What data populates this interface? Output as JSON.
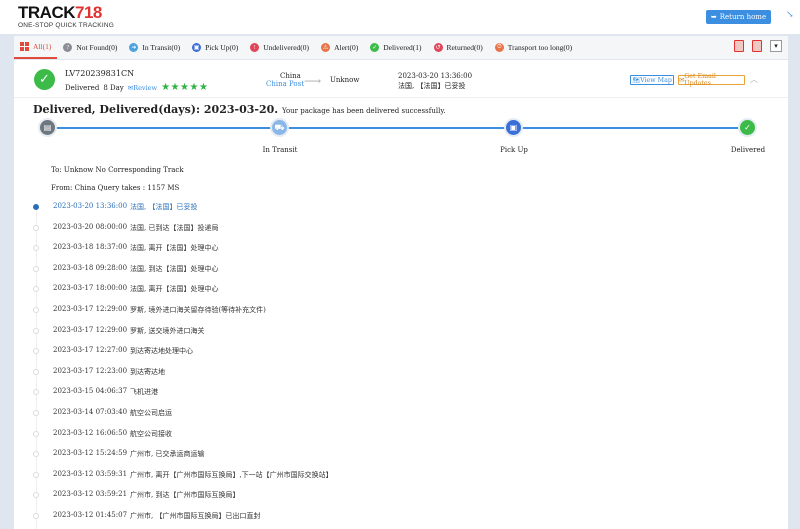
{
  "brand": {
    "logo_a": "TRACK",
    "logo_b": "718",
    "tagline": "ONE-STOP QUICK TRACKING"
  },
  "header": {
    "return_label": "Return home"
  },
  "filters": [
    {
      "label": "All(1)",
      "icon": "grid-icon",
      "color": "#e24b3b"
    },
    {
      "label": "Not Found(0)",
      "icon": "not-found-icon",
      "color": "#8a8f96"
    },
    {
      "label": "In Transit(0)",
      "icon": "in-transit-icon",
      "color": "#4aa3df"
    },
    {
      "label": "Pick Up(0)",
      "icon": "pickup-icon",
      "color": "#3b6fd8"
    },
    {
      "label": "Undelivered(0)",
      "icon": "undelivered-icon",
      "color": "#e0455a"
    },
    {
      "label": "Alert(0)",
      "icon": "alert-icon",
      "color": "#e8744a"
    },
    {
      "label": "Delivered(1)",
      "icon": "delivered-icon",
      "color": "#3dbb48"
    },
    {
      "label": "Returned(0)",
      "icon": "returned-icon",
      "color": "#e0455a"
    },
    {
      "label": "Transport too long(0)",
      "icon": "transport-long-icon",
      "color": "#e8744a"
    }
  ],
  "package": {
    "tracking_number": "LV720239831CN",
    "status": "Delivered",
    "days": "8 Day",
    "review_label": "Review",
    "stars": "★★★★★",
    "origin_country": "China",
    "origin_carrier": "China Post",
    "destination": "Unknow",
    "latest_time": "2023-03-20 13:36:00",
    "latest_desc": "法国, 【法国】已妥投",
    "view_map": "View Map",
    "email_updates": "Get Email Updates"
  },
  "summary": {
    "headline": "Delivered, Delivered(days): 2023-03-20.",
    "subtext": "Your package has been delivered successfully."
  },
  "steps": [
    {
      "label": "",
      "icon": "info-box-icon",
      "color": "#6e7680"
    },
    {
      "label": "In Transit",
      "icon": "truck-icon",
      "color": "#8ab7e8"
    },
    {
      "label": "Pick Up",
      "icon": "pickup-box-icon",
      "color": "#3b6fd8"
    },
    {
      "label": "Delivered",
      "icon": "check-icon",
      "color": "#3dbb48"
    }
  ],
  "route_info": {
    "to_text": "To: Unknow    No Corresponding Track",
    "from_text": "From: China   Query takes : 1157 MS"
  },
  "events": [
    {
      "time": "2023-03-20 13:36:00",
      "desc": "法国, 【法国】已妥投"
    },
    {
      "time": "2023-03-20 08:00:00",
      "desc": "法国, 已到达【法国】投递局"
    },
    {
      "time": "2023-03-18 18:37:00",
      "desc": "法国, 离开【法国】处理中心"
    },
    {
      "time": "2023-03-18 09:28:00",
      "desc": "法国, 到达【法国】处理中心"
    },
    {
      "time": "2023-03-17 18:00:00",
      "desc": "法国, 离开【法国】处理中心"
    },
    {
      "time": "2023-03-17 12:29:00",
      "desc": "罗斯, 境外进口海关留存待验(等待补充文件)"
    },
    {
      "time": "2023-03-17 12:29:00",
      "desc": "罗斯, 送交境外进口海关"
    },
    {
      "time": "2023-03-17 12:27:00",
      "desc": "到达寄达地处理中心"
    },
    {
      "time": "2023-03-17 12:23:00",
      "desc": "到达寄达地"
    },
    {
      "time": "2023-03-15 04:06:37",
      "desc": "飞机进港"
    },
    {
      "time": "2023-03-14 07:03:40",
      "desc": "航空公司启运"
    },
    {
      "time": "2023-03-12 16:06:50",
      "desc": "航空公司接收"
    },
    {
      "time": "2023-03-12 15:24:59",
      "desc": "广州市, 已交承运商运输"
    },
    {
      "time": "2023-03-12 03:59:31",
      "desc": "广州市, 离开【广州市国际互换局】,下一站【广州市国际交换站】"
    },
    {
      "time": "2023-03-12 03:59:21",
      "desc": "广州市, 到达【广州市国际互换局】"
    },
    {
      "time": "2023-03-12 01:45:07",
      "desc": "广州市, 【广州市国际互换局】已出口直封"
    }
  ]
}
